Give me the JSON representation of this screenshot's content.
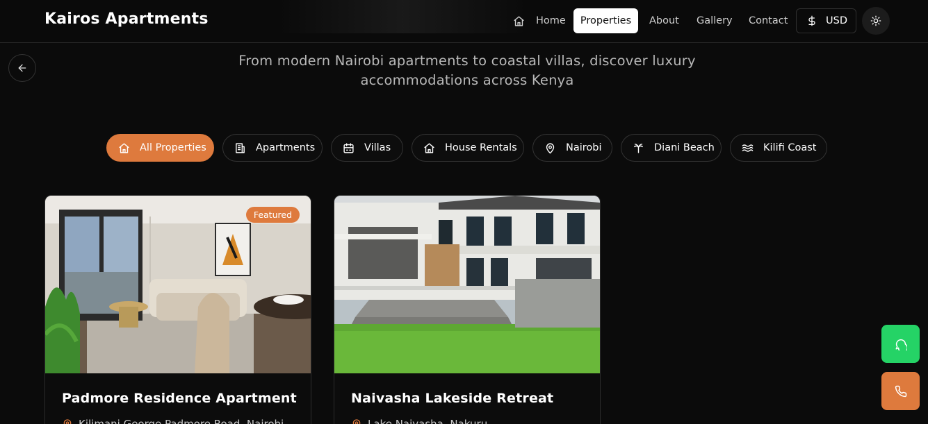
{
  "header": {
    "brand": "Kairos Apartments",
    "nav": [
      {
        "label": "Home",
        "icon": "home-icon"
      },
      {
        "label": "Properties",
        "active": true
      },
      {
        "label": "About"
      },
      {
        "label": "Gallery"
      },
      {
        "label": "Contact"
      }
    ],
    "currency": {
      "label": "USD",
      "icon": "dollar-icon"
    },
    "theme_toggle_icon": "sun-icon"
  },
  "hero": {
    "subtitle": "From modern Nairobi apartments to coastal villas, discover luxury accommodations across Kenya"
  },
  "filters": [
    {
      "label": "All Properties",
      "icon": "home-icon",
      "active": true
    },
    {
      "label": "Apartments",
      "icon": "building-icon"
    },
    {
      "label": "Villas",
      "icon": "hotel-icon"
    },
    {
      "label": "House Rentals",
      "icon": "home-icon"
    },
    {
      "label": "Nairobi",
      "icon": "map-pin-icon"
    },
    {
      "label": "Diani Beach",
      "icon": "palm-tree-icon"
    },
    {
      "label": "Kilifi Coast",
      "icon": "waves-icon"
    }
  ],
  "properties": [
    {
      "title": "Padmore Residence Apartment",
      "location": "Kilimani George Padmore Road, Nairobi",
      "badge": "Featured"
    },
    {
      "title": "Naivasha Lakeside Retreat",
      "location": "Lake Naivasha, Nakuru"
    }
  ],
  "colors": {
    "accent": "#de7a3d",
    "whatsapp": "#25d366",
    "background": "#0b0b0b"
  }
}
